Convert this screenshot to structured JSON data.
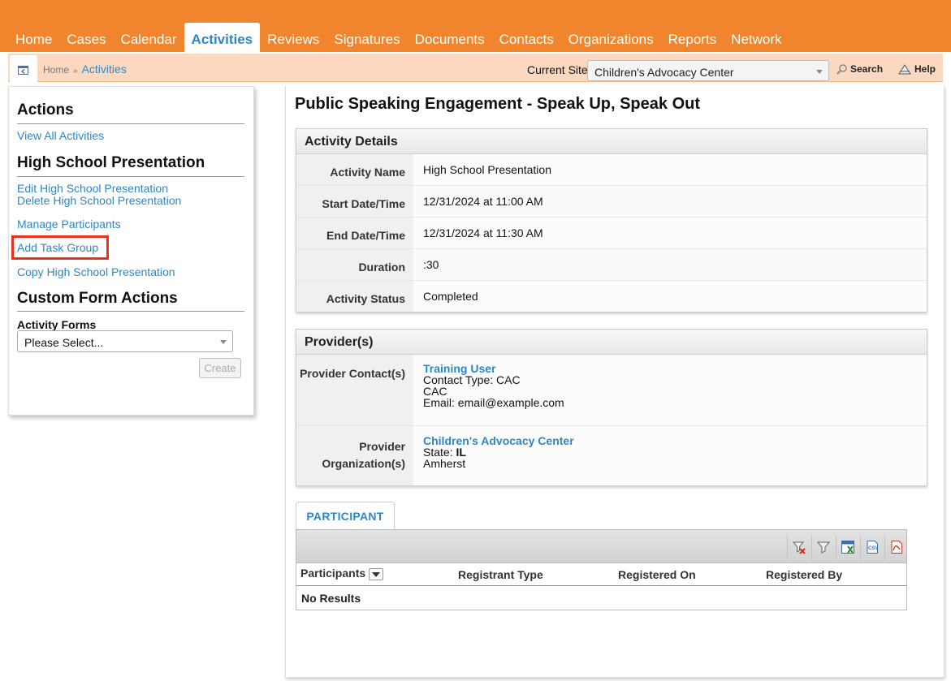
{
  "nav": {
    "tabs": [
      "Home",
      "Cases",
      "Calendar",
      "Activities",
      "Reviews",
      "Signatures",
      "Documents",
      "Contacts",
      "Organizations",
      "Reports",
      "Network"
    ],
    "active": "Activities"
  },
  "breadcrumb": {
    "home": "Home",
    "sep": "»",
    "current": "Activities"
  },
  "site": {
    "label": "Current Site",
    "value": "Children's Advocacy Center"
  },
  "toplinks": {
    "search": "Search",
    "help": "Help"
  },
  "sidebar": {
    "actions_heading": "Actions",
    "view_all": "View All Activities",
    "section_heading": "High School Presentation",
    "edit": "Edit High School Presentation",
    "delete": "Delete High School Presentation",
    "manage": "Manage Participants",
    "add_task_group": "Add Task Group",
    "copy": "Copy High School Presentation",
    "custom_heading": "Custom Form Actions",
    "forms_label": "Activity Forms",
    "forms_select": "Please Select...",
    "create": "Create"
  },
  "main": {
    "title": "Public Speaking Engagement - Speak Up, Speak Out",
    "details": {
      "heading": "Activity Details",
      "rows": [
        {
          "label": "Activity Name",
          "value": "High School Presentation"
        },
        {
          "label": "Start Date/Time",
          "value": "12/31/2024 at 11:00 AM"
        },
        {
          "label": "End Date/Time",
          "value": "12/31/2024 at 11:30 AM"
        },
        {
          "label": "Duration",
          "value": ":30"
        },
        {
          "label": "Activity Status",
          "value": "Completed"
        }
      ]
    },
    "providers": {
      "heading": "Provider(s)",
      "contact_label": "Provider Contact(s)",
      "contact_name": "Training User",
      "contact_type": "Contact Type: CAC",
      "contact_org": "CAC",
      "contact_email": "Email: email@example.com",
      "org_label_1": "Provider",
      "org_label_2": "Organization(s)",
      "org_name": "Children's Advocacy Center",
      "org_state_label": "State: ",
      "org_state": "IL",
      "org_city": "Amherst"
    },
    "tab": "PARTICIPANT",
    "grid": {
      "toolbar_icons": [
        "clear-filter-icon",
        "filter-icon",
        "excel-export-icon",
        "csv-export-icon",
        "pdf-export-icon"
      ],
      "columns": [
        "Participants",
        "Registrant Type",
        "Registered On",
        "Registered By"
      ],
      "empty": "No Results"
    }
  }
}
